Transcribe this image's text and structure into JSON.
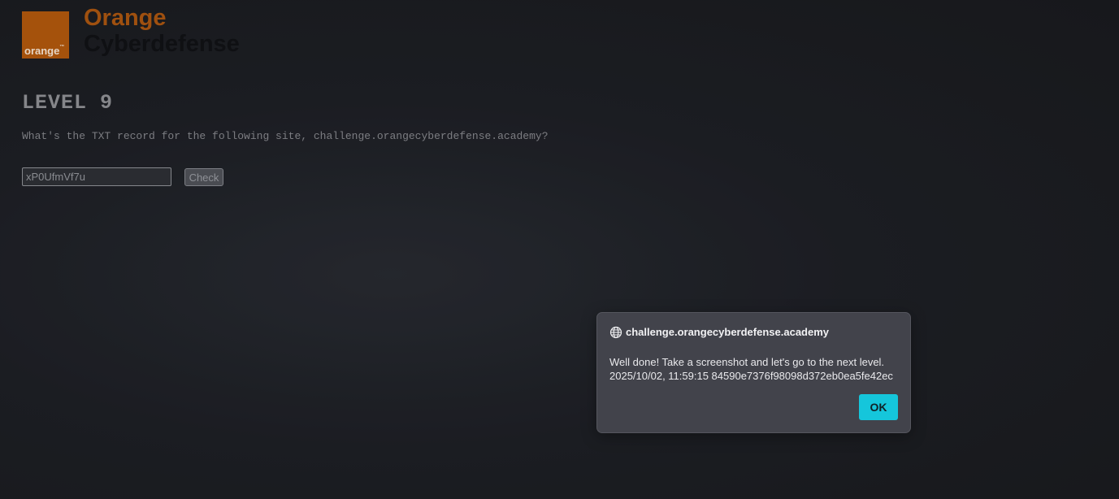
{
  "logo": {
    "box_text": "orange",
    "trademark": "™",
    "brand_line1": "Orange",
    "brand_line2": "Cyberdefense",
    "brand_color": "#a5520c"
  },
  "challenge": {
    "level_title": "LEVEL 9",
    "question": "What's the TXT record for the following site, challenge.orangecyberdefense.academy?",
    "answer_value": "xP0UfmVf7u",
    "check_label": "Check"
  },
  "dialog": {
    "icon": "globe-icon",
    "origin": "challenge.orangecyberdefense.academy",
    "message_line1": "Well done! Take a screenshot and let's go to the next level.",
    "message_line2": "2025/10/02, 11:59:15 84590e7376f98098d372eb0ea5fe42ec",
    "ok_label": "OK",
    "ok_color": "#15c6db"
  }
}
